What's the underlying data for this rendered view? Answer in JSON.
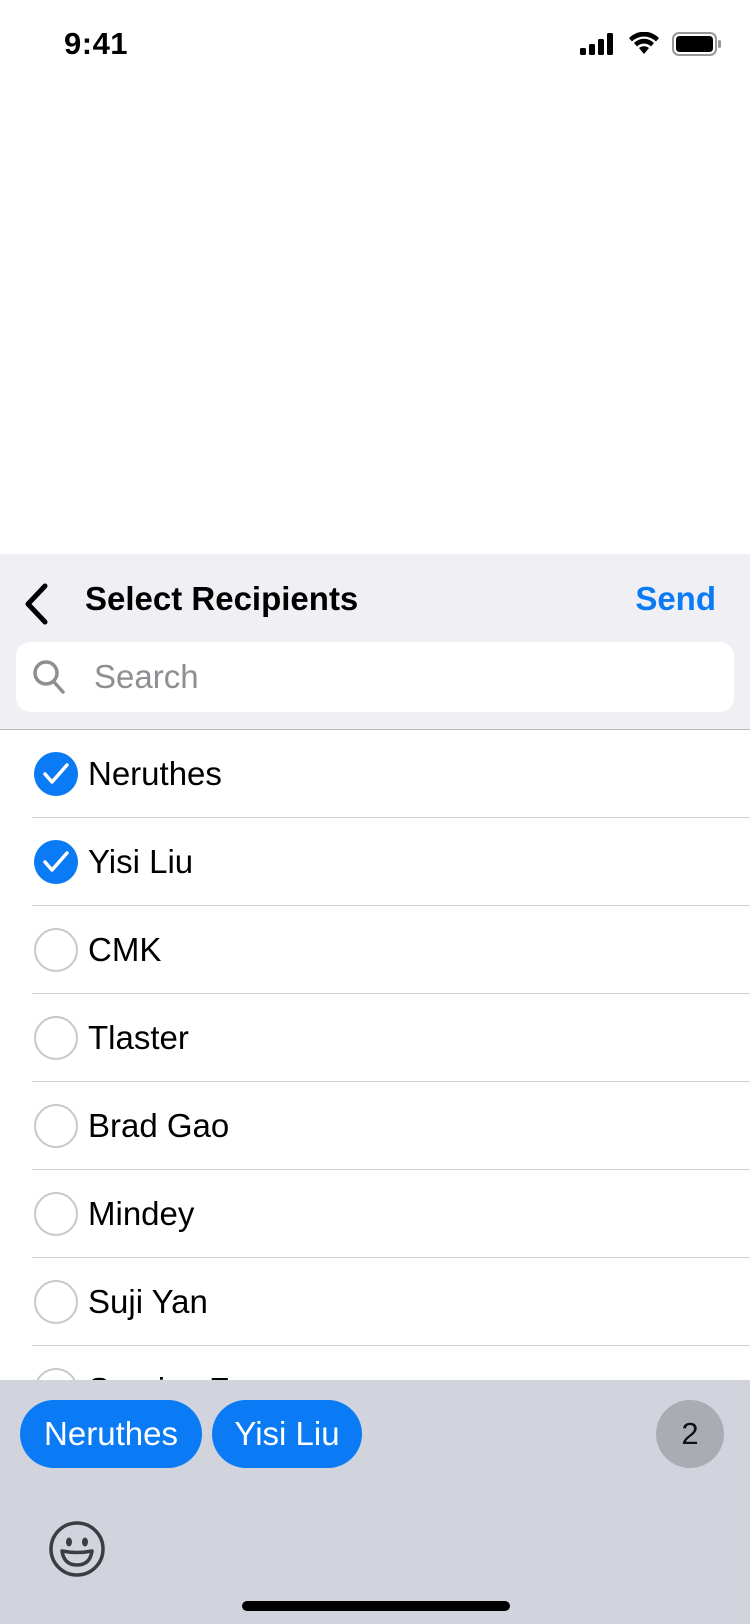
{
  "status_bar": {
    "time": "9:41"
  },
  "sheet": {
    "title": "Select Recipients",
    "send_label": "Send",
    "search_placeholder": "Search"
  },
  "recipients": [
    {
      "name": "Neruthes",
      "selected": true
    },
    {
      "name": "Yisi Liu",
      "selected": true
    },
    {
      "name": "CMK",
      "selected": false
    },
    {
      "name": "Tlaster",
      "selected": false
    },
    {
      "name": "Brad Gao",
      "selected": false
    },
    {
      "name": "Mindey",
      "selected": false
    },
    {
      "name": "Suji Yan",
      "selected": false
    },
    {
      "name": "Sunrise F",
      "selected": false
    }
  ],
  "selected_chips": [
    "Neruthes",
    "Yisi Liu"
  ],
  "selected_count": "2",
  "colors": {
    "accent": "#0a7bf5",
    "panel": "#d1d4dc",
    "header": "#efeff4"
  },
  "icons": [
    "back-chevron-icon",
    "search-icon",
    "checkmark-icon",
    "emoji-icon",
    "signal-icon",
    "wifi-icon",
    "battery-icon"
  ]
}
